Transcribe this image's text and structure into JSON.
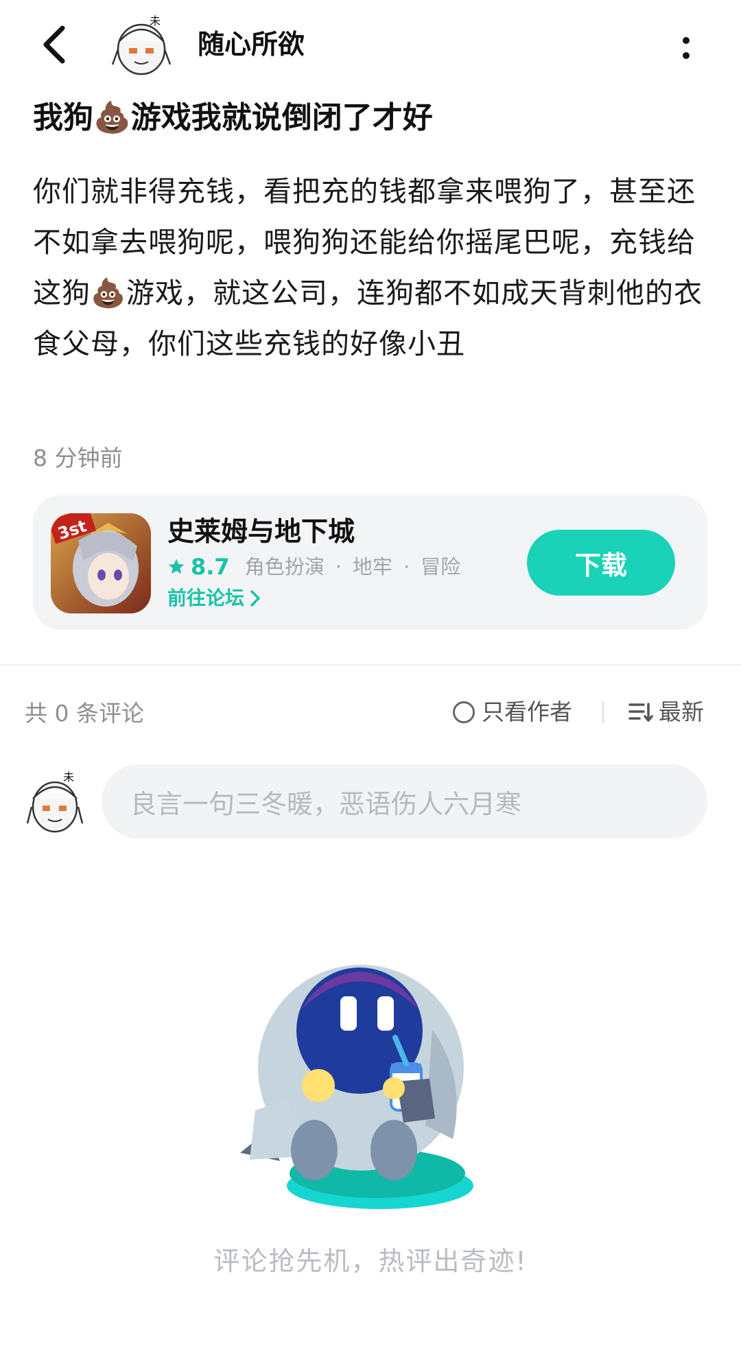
{
  "header": {
    "author_name": "随心所欲"
  },
  "post": {
    "title": "我狗💩游戏我就说倒闭了才好",
    "body": "你们就非得充钱，看把充的钱都拿来喂狗了，甚至还不如拿去喂狗呢，喂狗狗还能给你摇尾巴呢，充钱给这狗💩游戏，就这公司，连狗都不如成天背刺他的衣食父母，你们这些充钱的好像小丑",
    "time": "8 分钟前"
  },
  "game_card": {
    "name": "史莱姆与地下城",
    "rating": "8.7",
    "tags": [
      "角色扮演",
      "地牢",
      "冒险"
    ],
    "tag_separator": "·",
    "forum_link": "前往论坛",
    "download_label": "下载",
    "icon_badge": "3st"
  },
  "comments": {
    "count_text": "共 0 条评论",
    "author_only_label": "只看作者",
    "sort_label": "最新",
    "input_placeholder": "良言一句三冬暖，恶语伤人六月寒",
    "empty_text": "评论抢先机，热评出奇迹!"
  },
  "colors": {
    "accent": "#19d2b7",
    "accent_text": "#17c3a7",
    "muted": "#8e8e93",
    "card_bg": "#f3f4f6"
  },
  "icons": [
    "back-arrow-icon",
    "more-vertical-icon",
    "star-icon",
    "chevron-right-icon",
    "radio-icon",
    "sort-list-icon"
  ]
}
